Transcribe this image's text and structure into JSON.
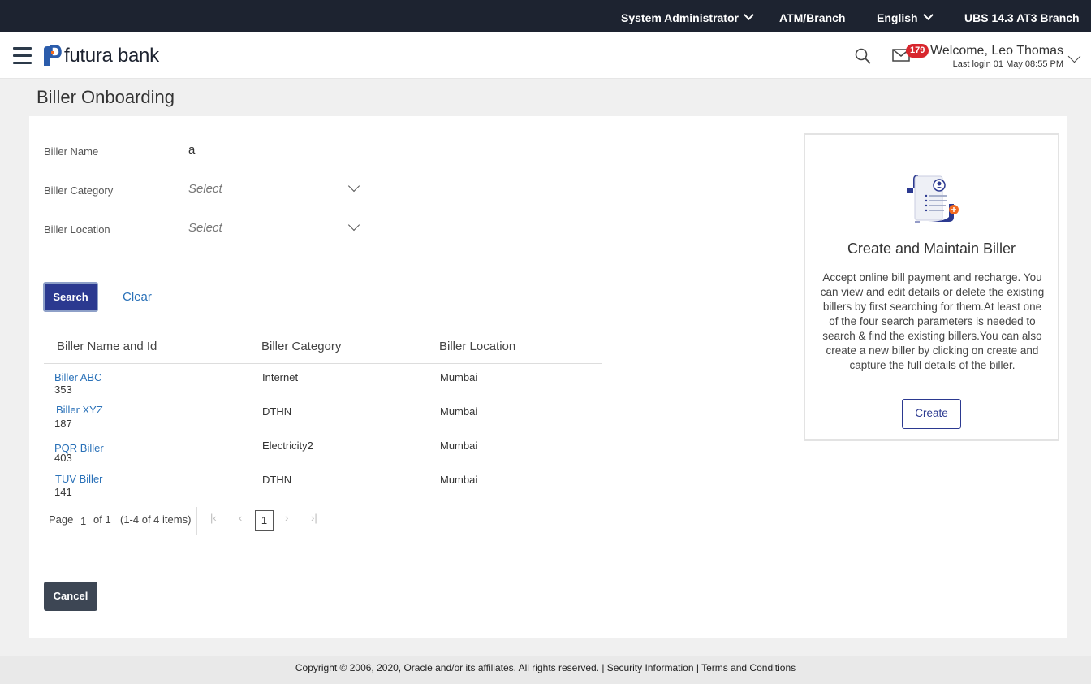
{
  "topbar": {
    "role": "System Administrator",
    "atm_branch": "ATM/Branch",
    "language": "English",
    "version": "UBS 14.3 AT3 Branch"
  },
  "header": {
    "brand": "futura bank",
    "notification_count": "179",
    "welcome": "Welcome, Leo Thomas",
    "last_login": "Last login 01 May 08:55 PM"
  },
  "page": {
    "title": "Biller Onboarding"
  },
  "form": {
    "biller_name_label": "Biller Name",
    "biller_name_value": "a",
    "biller_category_label": "Biller Category",
    "biller_category_placeholder": "Select",
    "biller_location_label": "Biller Location",
    "biller_location_placeholder": "Select",
    "search_label": "Search",
    "clear_label": "Clear"
  },
  "table": {
    "headers": [
      "Biller Name and Id",
      "Biller Category",
      "Biller Location"
    ],
    "rows": [
      {
        "name": "Biller ABC",
        "id": "353",
        "category": "Internet",
        "location": "Mumbai"
      },
      {
        "name": "Biller XYZ",
        "id": "187",
        "category": "DTHN",
        "location": "Mumbai"
      },
      {
        "name": "PQR Biller",
        "id": "403",
        "category": "Electricity2",
        "location": "Mumbai"
      },
      {
        "name": "TUV Biller",
        "id": "141",
        "category": "DTHN",
        "location": "Mumbai"
      }
    ]
  },
  "pagination": {
    "page_label": "Page",
    "page_number": "1",
    "of_label": "of 1",
    "items_label": "(1-4 of 4 items)",
    "current": "1"
  },
  "actions": {
    "cancel_label": "Cancel"
  },
  "card": {
    "title": "Create and Maintain Biller",
    "description": "Accept online bill payment and recharge. You can view and edit details or delete the existing billers by first searching for them.At least one of the four search parameters is needed to search & find the existing billers.You can also create a new biller by clicking on create and capture the full details of the biller.",
    "create_label": "Create"
  },
  "footer": {
    "copyright": "Copyright © 2006, 2020, Oracle and/or its affiliates. All rights reserved. | Security Information | Terms and Conditions"
  },
  "colors": {
    "topbar": "#1d2330",
    "primary_button": "#2b3990",
    "link": "#2a71b8",
    "badge": "#d8262d",
    "cancel_button": "#3d4654"
  },
  "icons": [
    "hamburger-icon",
    "futura-logo",
    "search-icon",
    "mail-icon",
    "chevron-down-icon",
    "biller-illustration"
  ]
}
